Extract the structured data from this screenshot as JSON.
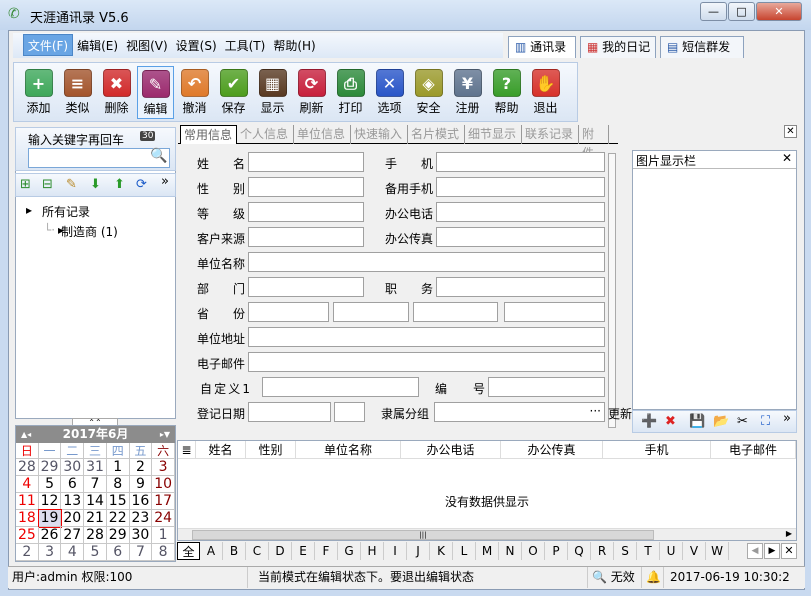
{
  "window": {
    "title": "天涯通讯录 V5.6",
    "minimize": "—",
    "maximize": "□",
    "close": "✕"
  },
  "menu": [
    "文件(F)",
    "编辑(E)",
    "视图(V)",
    "设置(S)",
    "工具(T)",
    "帮助(H)"
  ],
  "top_tabs": [
    {
      "label": "通讯录",
      "icon": "📖"
    },
    {
      "label": "我的日记",
      "icon": "▦"
    },
    {
      "label": "短信群发",
      "icon": "▤"
    }
  ],
  "toolbar": [
    {
      "label": "添加",
      "icon": "add-user",
      "glyph": "+",
      "color": "#3fa85a"
    },
    {
      "label": "类似",
      "icon": "copy-user",
      "glyph": "≡",
      "color": "#a4552c"
    },
    {
      "label": "删除",
      "icon": "delete",
      "glyph": "✖",
      "color": "#d22b2b"
    },
    {
      "label": "编辑",
      "icon": "edit",
      "glyph": "✎",
      "color": "#9c2a6e"
    },
    {
      "label": "撤消",
      "icon": "undo",
      "glyph": "↶",
      "color": "#e07a2a"
    },
    {
      "label": "保存",
      "icon": "save",
      "glyph": "✔",
      "color": "#4e9e1e"
    },
    {
      "label": "显示",
      "icon": "display",
      "glyph": "▦",
      "color": "#5a3a22"
    },
    {
      "label": "刷新",
      "icon": "refresh",
      "glyph": "⟳",
      "color": "#c8203c"
    },
    {
      "label": "打印",
      "icon": "print",
      "glyph": "⎙",
      "color": "#2d8a3a"
    },
    {
      "label": "选项",
      "icon": "tools",
      "glyph": "✕",
      "color": "#2a56c8"
    },
    {
      "label": "安全",
      "icon": "shield",
      "glyph": "◈",
      "color": "#9c9a2a"
    },
    {
      "label": "注册",
      "icon": "register",
      "glyph": "¥",
      "color": "#60748e"
    },
    {
      "label": "帮助",
      "icon": "help",
      "glyph": "?",
      "color": "#3a9e2a"
    },
    {
      "label": "退出",
      "icon": "exit",
      "glyph": "✋",
      "color": "#d8322a"
    }
  ],
  "search": {
    "label": "输入关键字再回车",
    "value": "",
    "calendar_badge": "30"
  },
  "tree": {
    "root": "所有记录",
    "child": "制造商 (1)"
  },
  "calendar": {
    "title": "2017年6月",
    "weekdays": [
      "日",
      "一",
      "二",
      "三",
      "四",
      "五",
      "六"
    ],
    "days": [
      28,
      29,
      30,
      31,
      1,
      2,
      3,
      4,
      5,
      6,
      7,
      8,
      9,
      10,
      11,
      12,
      13,
      14,
      15,
      16,
      17,
      18,
      19,
      20,
      21,
      22,
      23,
      24,
      25,
      26,
      27,
      28,
      29,
      30,
      1,
      2,
      3,
      4,
      5,
      6,
      7,
      8
    ],
    "selected": 19
  },
  "form_tabs": [
    "常用信息",
    "个人信息",
    "单位信息",
    "快速输入",
    "名片模式",
    "细节显示",
    "联系记录",
    "附件"
  ],
  "fields": {
    "name": "姓　名",
    "mobile": "手　机",
    "gender": "性　别",
    "mobile2": "备用手机",
    "level": "等　级",
    "office_phone": "办公电话",
    "source": "客户来源",
    "office_fax": "办公传真",
    "company": "单位名称",
    "dept": "部　门",
    "title": "职　务",
    "province": "省　份",
    "address": "单位地址",
    "email": "电子邮件",
    "custom1": "自定义1",
    "number": "编　号",
    "reg_date": "登记日期",
    "group": "隶属分组",
    "group_btn": "···",
    "update": "更新"
  },
  "picture_panel": {
    "title": "图片显示栏",
    "close": "✕",
    "tools": [
      "➕",
      "✖",
      "💾",
      "📂",
      "✂",
      "⛶"
    ],
    "more": "»"
  },
  "grid": {
    "columns": [
      "姓名",
      "性别",
      "单位名称",
      "办公电话",
      "办公传真",
      "手机",
      "电子邮件"
    ],
    "empty": "没有数据供显示",
    "scroll_grip": "|||"
  },
  "letters": [
    "全",
    "A",
    "B",
    "C",
    "D",
    "E",
    "F",
    "G",
    "H",
    "I",
    "J",
    "K",
    "L",
    "M",
    "N",
    "O",
    "P",
    "Q",
    "R",
    "S",
    "T",
    "U",
    "V",
    "W"
  ],
  "status": {
    "user": "用户:admin  权限:100",
    "mode": "当前模式在编辑状态下。要退出编辑状态",
    "validity": "无效",
    "datetime": "2017-06-19  10:30:2"
  }
}
